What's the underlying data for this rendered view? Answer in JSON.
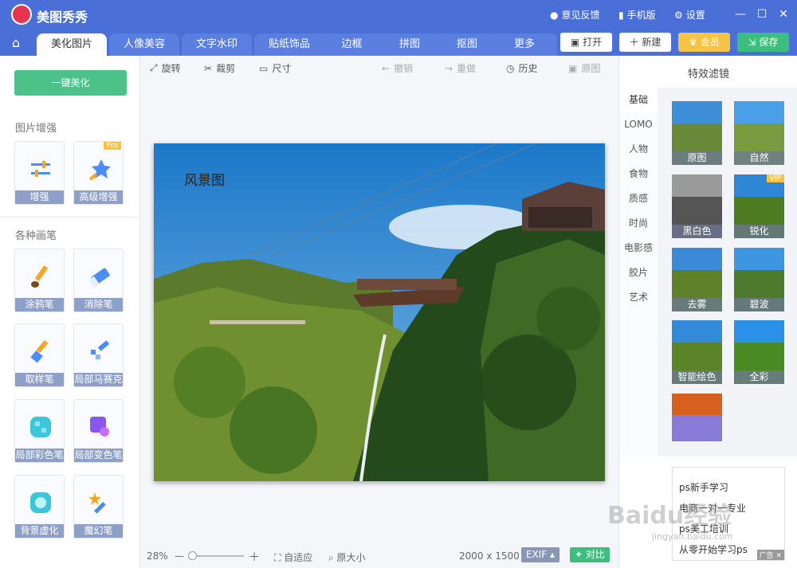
{
  "app": {
    "name": "美图秀秀",
    "feedback": "意见反馈",
    "mobile": "手机版",
    "settings": "设置"
  },
  "tabs": [
    "美化图片",
    "人像美容",
    "文字水印",
    "贴纸饰品",
    "边框",
    "拼图",
    "抠图",
    "更多"
  ],
  "actions": {
    "open": "打开",
    "new": "新建",
    "member": "会员",
    "save": "保存"
  },
  "left": {
    "onekey": "一键美化",
    "enhance_title": "图片增强",
    "enhance": [
      "增强",
      "高级增强"
    ],
    "pro": "Pro",
    "brush_title": "各种画笔",
    "brushes": [
      "涂鸦笔",
      "消除笔",
      "取样笔",
      "局部马赛克",
      "局部彩色笔",
      "局部变色笔",
      "背景虚化",
      "魔幻笔"
    ]
  },
  "toolbar": {
    "rotate": "旋转",
    "crop": "裁剪",
    "size": "尺寸",
    "undo": "撤销",
    "redo": "重做",
    "history": "历史",
    "original": "原图"
  },
  "canvas": {
    "caption": "风景图"
  },
  "status": {
    "zoom": "28%",
    "fit": "自适应",
    "actual": "原大小",
    "dims": "2000 x 1500",
    "exif": "EXIF",
    "compare": "对比"
  },
  "right": {
    "title": "特效滤镜",
    "categories": [
      "基础",
      "LOMO",
      "人物",
      "食物",
      "质感",
      "时尚",
      "电影感",
      "胶片",
      "艺术"
    ],
    "filters": [
      "原图",
      "自然",
      "黑白色",
      "锐化",
      "去雾",
      "碧波",
      "智能绘色",
      "全彩"
    ],
    "vip": "VIP"
  },
  "ad": {
    "lines": [
      "ps新手学习",
      "电商一对一专业",
      "ps美工培训",
      "从零开始学习ps"
    ],
    "tag": "广告"
  },
  "watermark": {
    "brand": "Baidu经验",
    "url": "jingyan.baidu.com"
  }
}
